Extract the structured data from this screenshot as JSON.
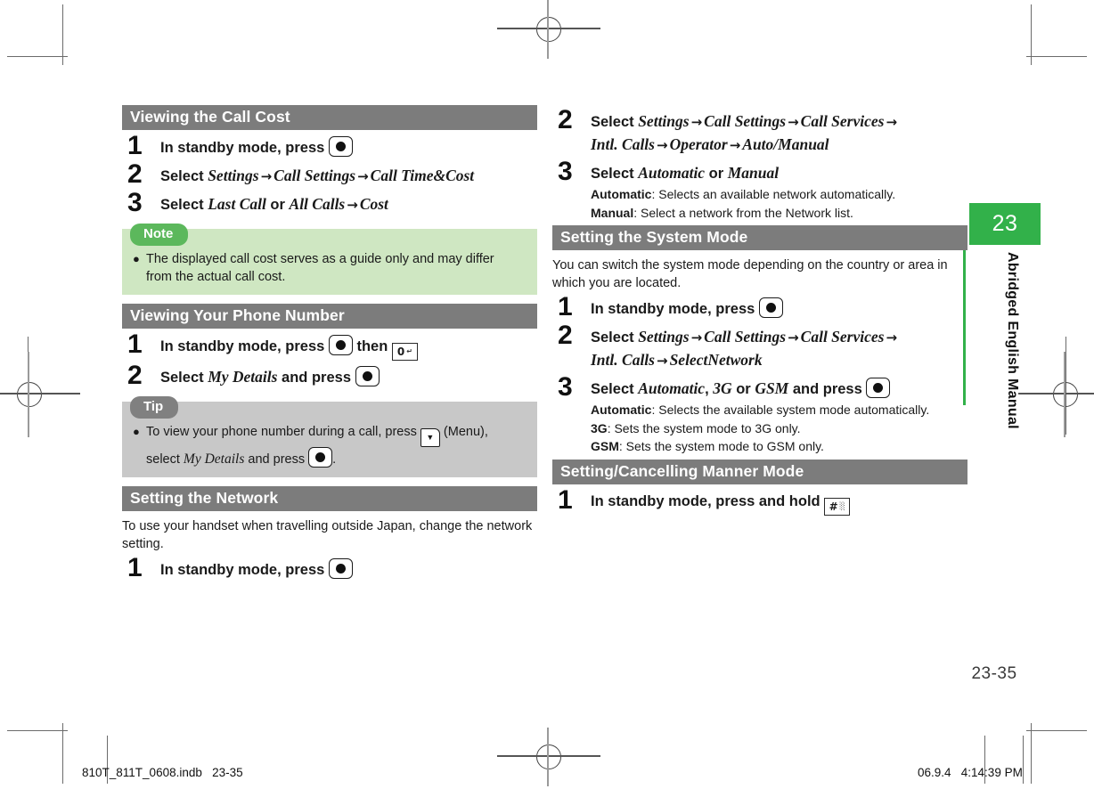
{
  "page": {
    "tab_number": "23",
    "side_label": "Abridged English Manual",
    "page_number": "23-35"
  },
  "footer": {
    "left": "810T_811T_0608.indb   23-35",
    "right": "06.9.4   4:14:39 PM"
  },
  "colors": {
    "section_bar": "#7c7c7c",
    "note_tab": "#5cb85c",
    "note_body": "#cfe7c2",
    "tip_tab": "#808080",
    "tip_body": "#c8c8c8",
    "brand_green": "#32b14a"
  },
  "left_column": {
    "sections": [
      {
        "heading": "Viewing the Call Cost",
        "steps": [
          {
            "num": "1",
            "parts": [
              {
                "t": "b",
                "v": "In standby mode, press "
              },
              {
                "t": "key-center"
              }
            ]
          },
          {
            "num": "2",
            "parts": [
              {
                "t": "b",
                "v": "Select "
              },
              {
                "t": "i",
                "v": "Settings"
              },
              {
                "t": "arrow"
              },
              {
                "t": "i",
                "v": "Call Settings"
              },
              {
                "t": "arrow"
              },
              {
                "t": "i",
                "v": "Call Time&Cost"
              }
            ]
          },
          {
            "num": "3",
            "parts": [
              {
                "t": "b",
                "v": "Select "
              },
              {
                "t": "i",
                "v": "Last Call"
              },
              {
                "t": "b",
                "v": " or "
              },
              {
                "t": "i",
                "v": "All Calls"
              },
              {
                "t": "arrow"
              },
              {
                "t": "i",
                "v": "Cost"
              }
            ]
          }
        ],
        "callout": {
          "kind": "note",
          "tab": "Note",
          "items": [
            "The displayed call cost serves as a guide only and may differ from the actual call cost."
          ]
        }
      },
      {
        "heading": "Viewing Your Phone Number",
        "steps": [
          {
            "num": "1",
            "parts": [
              {
                "t": "b",
                "v": "In standby mode, press "
              },
              {
                "t": "key-center"
              },
              {
                "t": "b",
                "v": " then "
              },
              {
                "t": "key-zero"
              }
            ]
          },
          {
            "num": "2",
            "parts": [
              {
                "t": "b",
                "v": "Select "
              },
              {
                "t": "i",
                "v": "My Details"
              },
              {
                "t": "b",
                "v": " and press "
              },
              {
                "t": "key-center"
              }
            ]
          }
        ],
        "callout": {
          "kind": "tip",
          "tab": "Tip",
          "items": [
            "tip-rich"
          ]
        }
      },
      {
        "heading": "Setting the Network",
        "intro": "To use your handset when travelling outside Japan, change the network setting.",
        "steps": [
          {
            "num": "1",
            "parts": [
              {
                "t": "b",
                "v": "In standby mode, press "
              },
              {
                "t": "key-center"
              }
            ]
          }
        ]
      }
    ],
    "tip_text": {
      "lead": "To view your phone number during a call, press ",
      "menu_label": " (Menu), select ",
      "italic1": "My Details",
      "after": " and press ",
      "period": "."
    }
  },
  "right_column": {
    "sections": [
      {
        "heading": null,
        "steps": [
          {
            "num": "2",
            "parts": [
              {
                "t": "b",
                "v": "Select "
              },
              {
                "t": "i",
                "v": "Settings"
              },
              {
                "t": "arrow"
              },
              {
                "t": "i",
                "v": "Call Settings"
              },
              {
                "t": "arrow"
              },
              {
                "t": "i",
                "v": "Call Services"
              },
              {
                "t": "arrow"
              },
              {
                "t": "br"
              },
              {
                "t": "i",
                "v": "Intl. Calls"
              },
              {
                "t": "arrow"
              },
              {
                "t": "i",
                "v": "Operator"
              },
              {
                "t": "arrow"
              },
              {
                "t": "i",
                "v": "Auto/Manual"
              }
            ]
          },
          {
            "num": "3",
            "parts": [
              {
                "t": "b",
                "v": "Select "
              },
              {
                "t": "i",
                "v": "Automatic"
              },
              {
                "t": "b",
                "v": " or "
              },
              {
                "t": "i",
                "v": "Manual"
              }
            ],
            "subs": [
              {
                "label": "Automatic",
                "text": ": Selects an available network automatically."
              },
              {
                "label": "Manual",
                "text": ": Select a network from the Network list."
              }
            ]
          }
        ]
      },
      {
        "heading": "Setting the System Mode",
        "intro": "You can switch the system mode depending on the country or area in which you are located.",
        "steps": [
          {
            "num": "1",
            "parts": [
              {
                "t": "b",
                "v": "In standby mode, press "
              },
              {
                "t": "key-center"
              }
            ]
          },
          {
            "num": "2",
            "parts": [
              {
                "t": "b",
                "v": "Select "
              },
              {
                "t": "i",
                "v": "Settings"
              },
              {
                "t": "arrow"
              },
              {
                "t": "i",
                "v": "Call Settings"
              },
              {
                "t": "arrow"
              },
              {
                "t": "i",
                "v": "Call Services"
              },
              {
                "t": "arrow"
              },
              {
                "t": "br"
              },
              {
                "t": "i",
                "v": "Intl. Calls"
              },
              {
                "t": "arrow"
              },
              {
                "t": "i",
                "v": "SelectNetwork"
              }
            ]
          },
          {
            "num": "3",
            "parts": [
              {
                "t": "b",
                "v": "Select "
              },
              {
                "t": "i",
                "v": "Automatic"
              },
              {
                "t": "b",
                "v": ", "
              },
              {
                "t": "i",
                "v": "3G"
              },
              {
                "t": "b",
                "v": " or "
              },
              {
                "t": "i",
                "v": "GSM"
              },
              {
                "t": "b",
                "v": " and press "
              },
              {
                "t": "key-center"
              }
            ],
            "subs": [
              {
                "label": "Automatic",
                "text": ": Selects the available system mode automatically."
              },
              {
                "label": "3G",
                "text": ": Sets the system mode to 3G only."
              },
              {
                "label": "GSM",
                "text": ": Sets the system mode to GSM only."
              }
            ]
          }
        ]
      },
      {
        "heading": "Setting/Cancelling Manner Mode",
        "steps": [
          {
            "num": "1",
            "parts": [
              {
                "t": "b",
                "v": "In standby mode, press and hold "
              },
              {
                "t": "key-hash"
              }
            ]
          }
        ]
      }
    ]
  },
  "icons": {
    "center_key": "center-select-key-icon",
    "zero_key": "zero-key-icon",
    "hash_key": "hash-key-icon",
    "menu_softkey": "menu-softkey-icon",
    "zero_glyph": "0",
    "hash_glyph": "#"
  }
}
